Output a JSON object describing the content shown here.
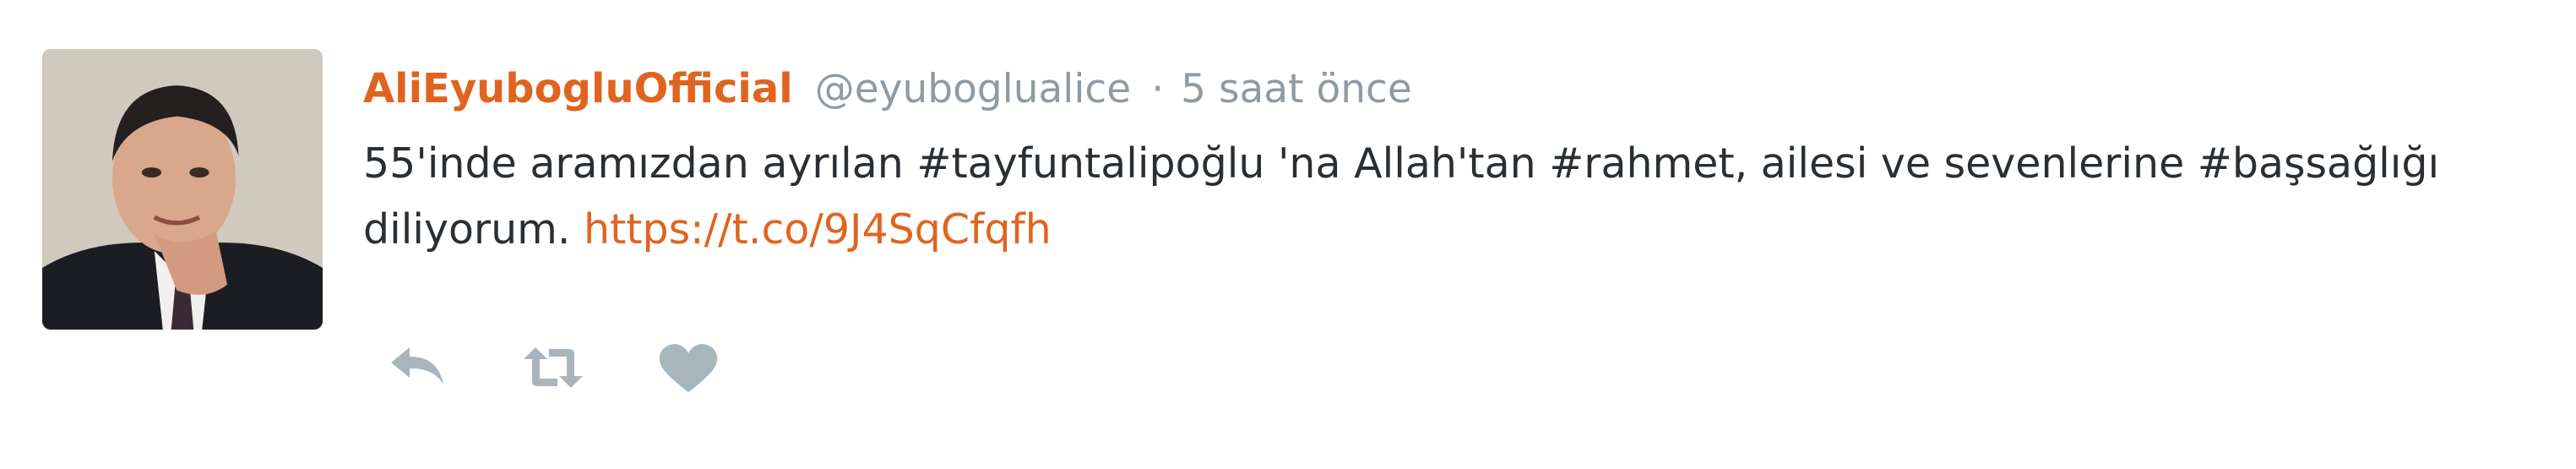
{
  "tweet": {
    "display_name": "AliEyubogluOfficial",
    "handle": "@eyuboglualice",
    "separator": "·",
    "time": "5 saat önce",
    "text_segments": [
      "55'inde aramızdan ayrılan #tayfuntalipoğlu 'na Allah'tan #rahmet, ailesi ve sevenlerine #başsağlığı diliyorum. ",
      "https://t.co/9J4SqCfqfh"
    ]
  },
  "actions": {
    "icons": [
      "reply-icon",
      "retweet-icon",
      "like-icon"
    ],
    "icon_color": "#a9b5bd"
  },
  "colors": {
    "accent": "#e0641f",
    "meta": "#8f9aa3",
    "text": "#292f33"
  }
}
